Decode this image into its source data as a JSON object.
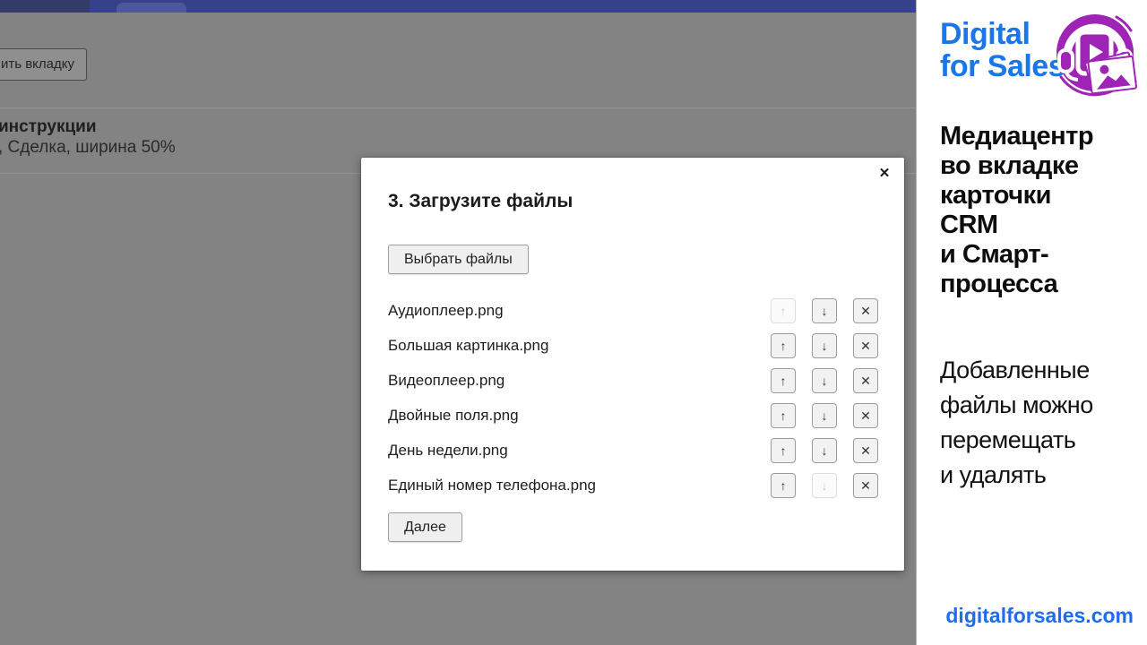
{
  "background_page": {
    "partial_button_label": "ить вкладку",
    "partial_heading": "инструкции",
    "partial_subtext": ", Сделка, ширина 50%"
  },
  "dialog": {
    "title": "3. Загрузите файлы",
    "close_icon": "✕",
    "choose_files_button": "Выбрать файлы",
    "next_button": "Далее",
    "icons": {
      "up": "↑",
      "down": "↓",
      "remove": "✕"
    },
    "files": [
      {
        "name": "Аудиоплеер.png",
        "up_disabled": true,
        "down_disabled": false
      },
      {
        "name": "Большая картинка.png",
        "up_disabled": false,
        "down_disabled": false
      },
      {
        "name": "Видеоплеер.png",
        "up_disabled": false,
        "down_disabled": false
      },
      {
        "name": "Двойные поля.png",
        "up_disabled": false,
        "down_disabled": false
      },
      {
        "name": "День недели.png",
        "up_disabled": false,
        "down_disabled": false
      },
      {
        "name": "Единый номер телефона.png",
        "up_disabled": false,
        "down_disabled": true
      }
    ]
  },
  "sidebar": {
    "brand_line1": "Digital",
    "brand_line2": "for Sales",
    "brand_color": "#1b76e8",
    "logo_color": "#9d24b4",
    "heading_lines": [
      "Медиацентр",
      "во вкладке",
      "карточки",
      "CRM",
      "и Смарт-",
      "процесса"
    ],
    "body_lines": [
      "Добавленные",
      "файлы можно",
      "перемещать",
      "и удалять"
    ],
    "site_url": "digitalforsales.com",
    "url_color": "#1f6cf0"
  }
}
